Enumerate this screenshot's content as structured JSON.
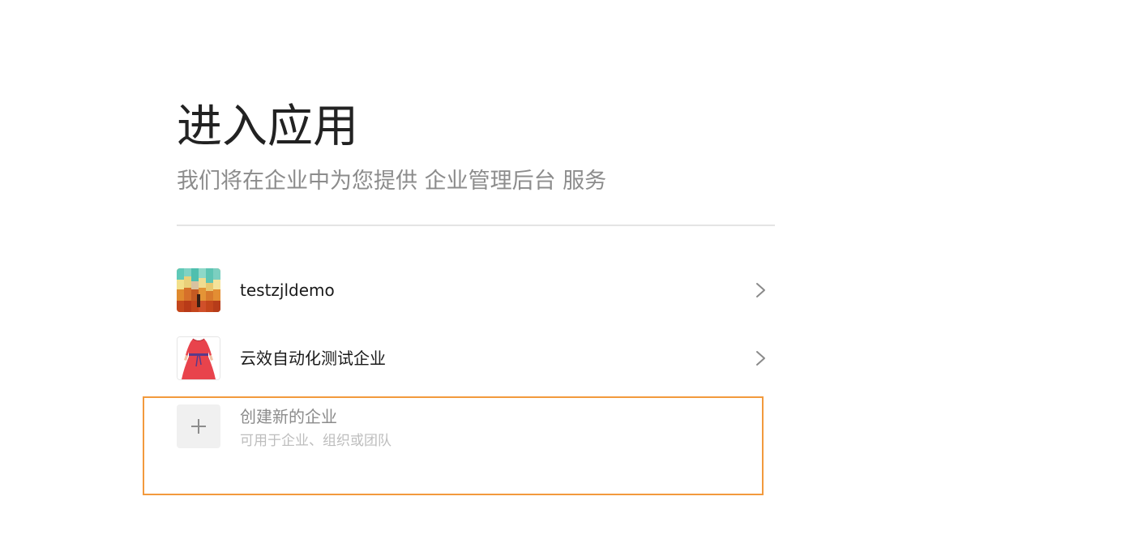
{
  "header": {
    "title": "进入应用",
    "subtitle": "我们将在企业中为您提供 企业管理后台 服务"
  },
  "organizations": [
    {
      "name": "testzjldemo",
      "avatar": "pixel-art-avatar"
    },
    {
      "name": "云效自动化测试企业",
      "avatar": "red-dress-avatar"
    }
  ],
  "create": {
    "title": "创建新的企业",
    "subtitle": "可用于企业、组织或团队",
    "icon": "plus-icon"
  },
  "colors": {
    "highlight_border": "#f29a3d",
    "title": "#222222",
    "subtitle": "#8c8c8c"
  }
}
